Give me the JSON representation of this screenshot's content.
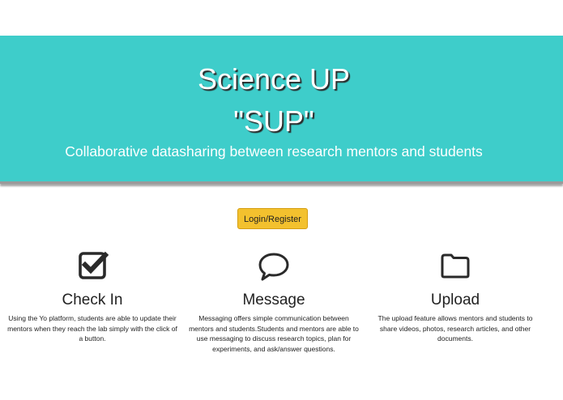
{
  "hero": {
    "title_line1": "Science UP",
    "title_line2": "\"SUP\"",
    "subtitle": "Collaborative datasharing between research mentors and students"
  },
  "login_button": "Login/Register",
  "features": [
    {
      "icon": "check-square-icon",
      "title": "Check In",
      "description": "Using the Yo platform, students are able to update their mentors when they reach the lab simply with the click of a button."
    },
    {
      "icon": "speech-bubble-icon",
      "title": "Message",
      "description": "Messaging offers simple communication between mentors and students.Students and mentors are able to use messaging to discuss research topics, plan for experiments, and ask/answer questions."
    },
    {
      "icon": "folder-icon",
      "title": "Upload",
      "description": "The upload feature allows mentors and students to share videos, photos, research articles, and other documents."
    }
  ],
  "colors": {
    "hero_bg": "#3ecdca",
    "button_bg": "#f3c12e"
  }
}
